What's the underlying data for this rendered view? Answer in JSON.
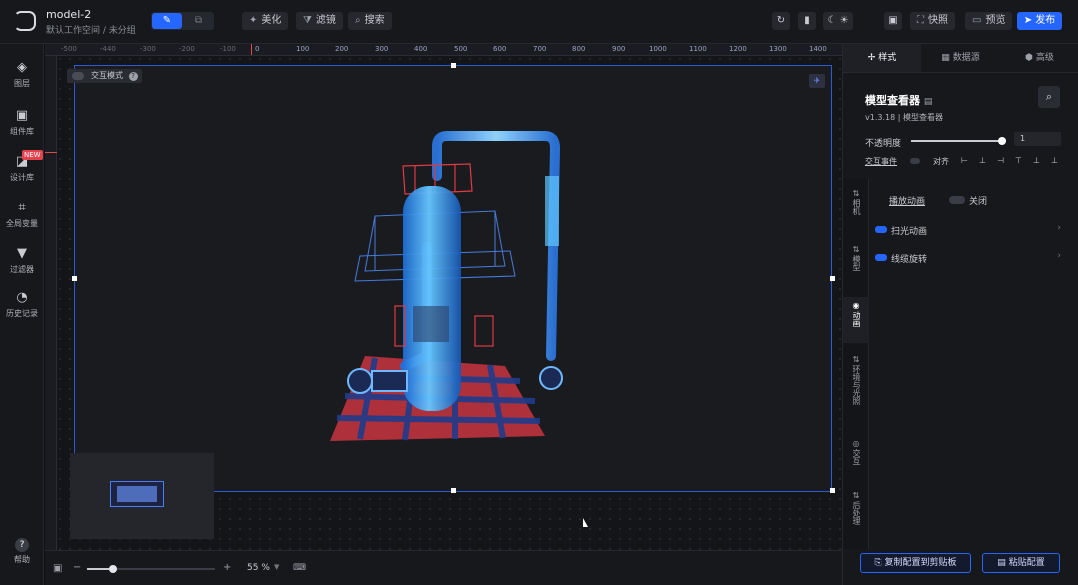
{
  "header": {
    "project_title": "model-2",
    "project_path": "默认工作空间 / 未分组",
    "mode_icons": [
      "edit-icon",
      "preview-mode-icon"
    ],
    "tools": [
      {
        "icon": "sparkle-icon",
        "glyph": "✦",
        "label": "美化"
      },
      {
        "icon": "filter-icon",
        "glyph": "⧩",
        "label": "滤镜"
      },
      {
        "icon": "search-icon",
        "glyph": "⌕",
        "label": "搜索"
      }
    ],
    "right_icons": [
      "refresh-icon",
      "layout-icon",
      "theme-icon"
    ],
    "actions": [
      {
        "icon": "screen-icon",
        "label": ""
      },
      {
        "icon": "snapshot-icon",
        "label": "快照"
      },
      {
        "icon": "preview-icon",
        "label": "预览"
      },
      {
        "icon": "publish-icon",
        "label": "发布"
      }
    ]
  },
  "left_nav": [
    {
      "icon": "layers-icon",
      "glyph": "◈",
      "label": "图层"
    },
    {
      "icon": "components-icon",
      "glyph": "▣",
      "label": "组件库"
    },
    {
      "icon": "design-icon",
      "glyph": "◪",
      "label": "设计库",
      "badge": "NEW"
    },
    {
      "icon": "variables-icon",
      "glyph": "⌗",
      "label": "全局变量"
    },
    {
      "icon": "filter-icon",
      "glyph": "▼",
      "label": "过滤器"
    },
    {
      "icon": "history-icon",
      "glyph": "◔",
      "label": "历史记录"
    }
  ],
  "help": {
    "glyph": "?",
    "label": "帮助"
  },
  "ruler": {
    "labels": [
      "-500",
      "-440",
      "-300",
      "-200",
      "-100",
      "0",
      "100",
      "200",
      "300",
      "400",
      "500",
      "600",
      "700",
      "800",
      "900",
      "1000",
      "1100",
      "1200",
      "1300",
      "1400"
    ]
  },
  "canvas": {
    "interact_mode_label": "交互模式",
    "help_glyph": "?"
  },
  "bottom": {
    "zoom_minus": "−",
    "zoom_plus": "+",
    "zoom_level": "55 %",
    "zoom_fraction": 0.2
  },
  "right_panel": {
    "tabs": [
      {
        "icon": "style-icon",
        "label": "样式"
      },
      {
        "icon": "database-icon",
        "label": "数据源"
      },
      {
        "icon": "advanced-icon",
        "label": "高级"
      }
    ],
    "component_name": "模型查看器",
    "version": "v1.3.18 | 模型查看器",
    "opacity_label": "不透明度",
    "opacity_value": "1",
    "opacity_fraction": 1.0,
    "interaction_label": "交互事件",
    "align_label": "对齐",
    "vertical_tabs": [
      "相机",
      "模型",
      "动画",
      "环境与光照",
      "交互",
      "后处理"
    ],
    "play_animation_label": "播放动画",
    "play_animation_state": "关闭",
    "sections": [
      "扫光动画",
      "线缆旋转"
    ],
    "copy_button": "复制配置到剪贴板",
    "paste_button": "粘贴配置"
  }
}
